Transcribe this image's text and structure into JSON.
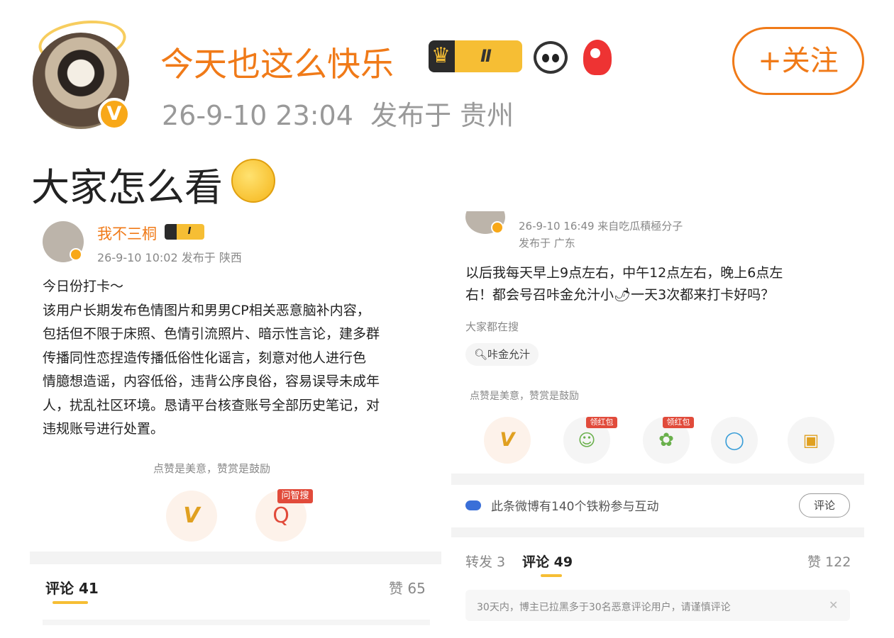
{
  "post": {
    "username": "今天也这么快乐",
    "vip_level": "Ⅱ",
    "follow_button": "+关注",
    "timestamp": "26-9-10 23:04",
    "location_label": "发布于 贵州",
    "text": "大家怎么看"
  },
  "left_screenshot": {
    "username": "我不三桐",
    "vip_level": "Ⅰ",
    "meta": "26-9-10 10:02  发布于 陕西",
    "body_lines": [
      "今日份打卡～",
      "该用户长期发布色情图片和男男CP相关恶意脑补内容，",
      "包括但不限于床照、色情引流照片、暗示性言论，建多群",
      "传播同性恋捏造传播低俗性化谣言，刻意对他人进行色",
      "情臆想造谣，内容低俗，违背公序良俗，容易误导未成年",
      "人，扰乱社区环境。恳请平台核查账号全部历史笔记，对",
      "违规账号进行处置。"
    ],
    "like_hint": "点赞是美意，赞赏是鼓励",
    "ask_badge": "问智搜",
    "comments_tab": "评论 41",
    "likes": "赞 65"
  },
  "right_screenshot": {
    "meta_line1": "26-9-10 16:49  来自吃瓜積極分子",
    "meta_line2": "发布于 广东",
    "body_lines": [
      "以后我每天早上9点左右，中午12点左右，晚上6点左",
      "右！都会号召咔金允汁小🌶一天3次都来打卡好吗？"
    ],
    "trending_label": "大家都在搜",
    "search_chip": "咔金允汁",
    "like_hint": "点赞是美意，赞赏是鼓励",
    "red_packet_1": "领红包",
    "red_packet_2": "领红包",
    "fans_notice": "此条微博有140个铁粉参与互动",
    "comment_button": "评论",
    "tab_repost": "转发 3",
    "tab_comments": "评论 49",
    "likes": "赞 122",
    "blocked_notice": "30天内，博主已拉黑多于30名恶意评论用户，请谨慎评论",
    "close_mark": "✕"
  },
  "colors": {
    "accent_orange": "#f07a18",
    "gold": "#f6be34",
    "hint_gray": "#999999"
  },
  "icons": {
    "reward": "weibo-v-reward-icon",
    "search": "magnifier-icon",
    "wechat": "wechat-icon",
    "moments": "wechat-moments-icon",
    "qq": "qq-icon",
    "save": "save-image-icon"
  }
}
